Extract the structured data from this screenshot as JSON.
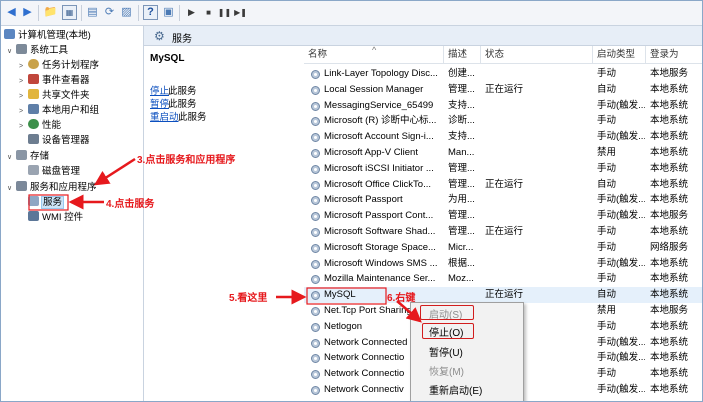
{
  "tree": {
    "root": "计算机管理(本地)",
    "system_tools": "系统工具",
    "task_scheduler": "任务计划程序",
    "event_viewer": "事件查看器",
    "shared_folders": "共享文件夹",
    "local_users": "本地用户和组",
    "performance": "性能",
    "device_manager": "设备管理器",
    "storage": "存储",
    "disk_management": "磁盘管理",
    "services_apps": "服务和应用程序",
    "services": "服务",
    "wmi": "WMI 控件"
  },
  "middle": {
    "header": "服务",
    "selected_service": "MySQL",
    "stop_link": "停止",
    "stop_suffix": "此服务",
    "pause_link": "暂停",
    "pause_suffix": "此服务",
    "restart_link": "重启动",
    "restart_suffix": "此服务"
  },
  "columns": {
    "name": "名称",
    "desc": "描述",
    "status": "状态",
    "startup": "启动类型",
    "logon": "登录为"
  },
  "services": [
    {
      "name": "Link-Layer Topology Disc...",
      "desc": "创建...",
      "status": "",
      "startup": "手动",
      "logon": "本地服务"
    },
    {
      "name": "Local Session Manager",
      "desc": "管理...",
      "status": "正在运行",
      "startup": "自动",
      "logon": "本地系统"
    },
    {
      "name": "MessagingService_65499",
      "desc": "支持...",
      "status": "",
      "startup": "手动(触发...",
      "logon": "本地系统"
    },
    {
      "name": "Microsoft (R) 诊断中心标...",
      "desc": "诊断...",
      "status": "",
      "startup": "手动",
      "logon": "本地系统"
    },
    {
      "name": "Microsoft Account Sign-i...",
      "desc": "支持...",
      "status": "",
      "startup": "手动(触发...",
      "logon": "本地系统"
    },
    {
      "name": "Microsoft App-V Client",
      "desc": "Man...",
      "status": "",
      "startup": "禁用",
      "logon": "本地系统"
    },
    {
      "name": "Microsoft iSCSI Initiator ...",
      "desc": "管理...",
      "status": "",
      "startup": "手动",
      "logon": "本地系统"
    },
    {
      "name": "Microsoft Office ClickTo...",
      "desc": "管理...",
      "status": "正在运行",
      "startup": "自动",
      "logon": "本地系统"
    },
    {
      "name": "Microsoft Passport",
      "desc": "为用...",
      "status": "",
      "startup": "手动(触发...",
      "logon": "本地系统"
    },
    {
      "name": "Microsoft Passport Cont...",
      "desc": "管理...",
      "status": "",
      "startup": "手动(触发...",
      "logon": "本地服务"
    },
    {
      "name": "Microsoft Software Shad...",
      "desc": "管理...",
      "status": "正在运行",
      "startup": "手动",
      "logon": "本地系统"
    },
    {
      "name": "Microsoft Storage Space...",
      "desc": "Micr...",
      "status": "",
      "startup": "手动",
      "logon": "网络服务"
    },
    {
      "name": "Microsoft Windows SMS ...",
      "desc": "根据...",
      "status": "",
      "startup": "手动(触发...",
      "logon": "本地系统"
    },
    {
      "name": "Mozilla Maintenance Ser...",
      "desc": "Moz...",
      "status": "",
      "startup": "手动",
      "logon": "本地系统"
    },
    {
      "name": "MySQL",
      "desc": "",
      "status": "正在运行",
      "startup": "自动",
      "logon": "本地系统"
    },
    {
      "name": "Net.Tcp Port Sharing",
      "desc": "",
      "status": "",
      "startup": "禁用",
      "logon": "本地服务"
    },
    {
      "name": "Netlogon",
      "desc": "",
      "status": "",
      "startup": "手动",
      "logon": "本地系统"
    },
    {
      "name": "Network Connected",
      "desc": "",
      "status": "",
      "startup": "手动(触发...",
      "logon": "本地系统"
    },
    {
      "name": "Network Connectio",
      "desc": "",
      "status": "",
      "startup": "手动(触发...",
      "logon": "本地系统"
    },
    {
      "name": "Network Connectio",
      "desc": "",
      "status": "",
      "startup": "手动",
      "logon": "本地系统"
    },
    {
      "name": "Network Connectiv",
      "desc": "",
      "status": "",
      "startup": "手动(触发...",
      "logon": "本地系统"
    }
  ],
  "context_menu": {
    "start": "启动(S)",
    "stop": "停止(O)",
    "pause": "暂停(U)",
    "resume": "恢复(M)",
    "restart": "重新启动(E)"
  },
  "annotations": {
    "step3": "3.点击服务和应用程序",
    "step4": "4.点击服务",
    "step5": "5.看这里",
    "step6": "6.右键"
  },
  "colors": {
    "annotation": "#e6191d",
    "selection": "#cce4f7",
    "link": "#0b4fbf",
    "header_bg": "#e7eef7"
  }
}
